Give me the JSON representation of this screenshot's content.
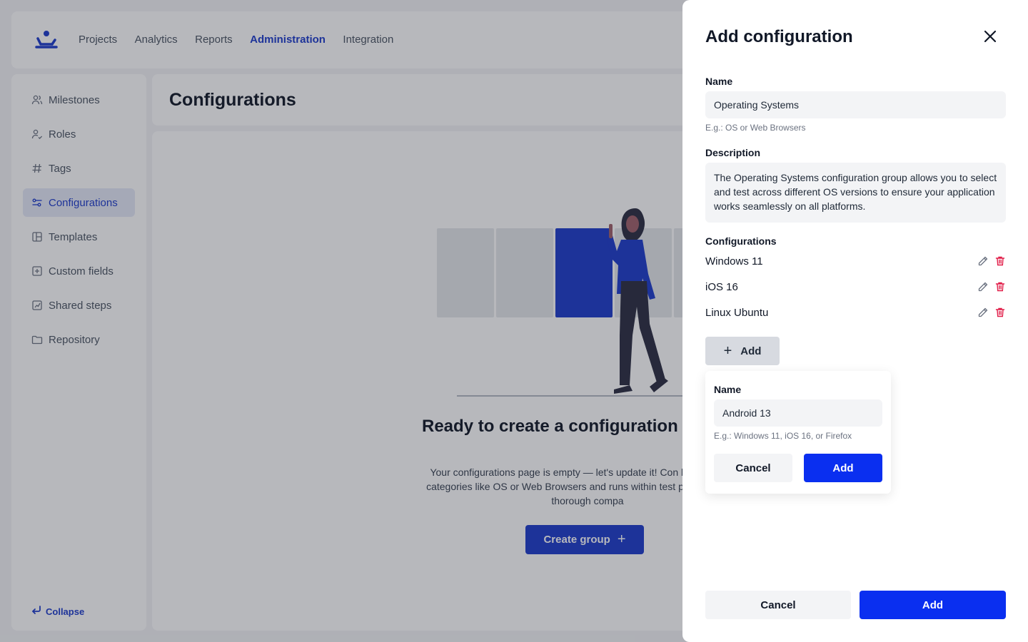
{
  "topnav": {
    "items": [
      {
        "label": "Projects",
        "active": false
      },
      {
        "label": "Analytics",
        "active": false
      },
      {
        "label": "Reports",
        "active": false
      },
      {
        "label": "Administration",
        "active": true
      },
      {
        "label": "Integration",
        "active": false
      }
    ]
  },
  "sidebar": {
    "items": [
      {
        "label": "Milestones",
        "icon": "users-icon"
      },
      {
        "label": "Roles",
        "icon": "user-check-icon"
      },
      {
        "label": "Tags",
        "icon": "hash-icon"
      },
      {
        "label": "Configurations",
        "icon": "sliders-icon",
        "active": true
      },
      {
        "label": "Templates",
        "icon": "layout-icon"
      },
      {
        "label": "Custom fields",
        "icon": "plus-square-icon"
      },
      {
        "label": "Shared steps",
        "icon": "chart-square-icon"
      },
      {
        "label": "Repository",
        "icon": "folder-icon"
      }
    ],
    "collapse_label": "Collapse"
  },
  "page": {
    "title": "Configurations",
    "empty_title": "Ready to create a configuration",
    "empty_desc": "Your configurations page is empty — let's update it! Con be grouped by categories like OS or Web Browsers and runs within test plans., ensuring thorough compa",
    "create_button": "Create group"
  },
  "drawer": {
    "title": "Add configuration",
    "name_label": "Name",
    "name_value": "Operating Systems",
    "name_hint": "E.g.: OS or Web Browsers",
    "description_label": "Description",
    "description_value": "The Operating Systems configuration group allows you to select and test across different OS versions to ensure your application works seamlessly on all platforms.",
    "configurations_label": "Configurations",
    "configurations": [
      {
        "name": "Windows 11"
      },
      {
        "name": "iOS 16"
      },
      {
        "name": "Linux Ubuntu"
      }
    ],
    "add_label": "Add",
    "popover": {
      "name_label": "Name",
      "name_value": "Android 13",
      "hint": "E.g.: Windows 11, iOS 16, or Firefox",
      "cancel": "Cancel",
      "add": "Add"
    },
    "footer": {
      "cancel": "Cancel",
      "add": "Add"
    }
  },
  "colors": {
    "accent": "#1d3bcc",
    "primary_button": "#0a2ff0",
    "delete_icon": "#e11d48"
  }
}
